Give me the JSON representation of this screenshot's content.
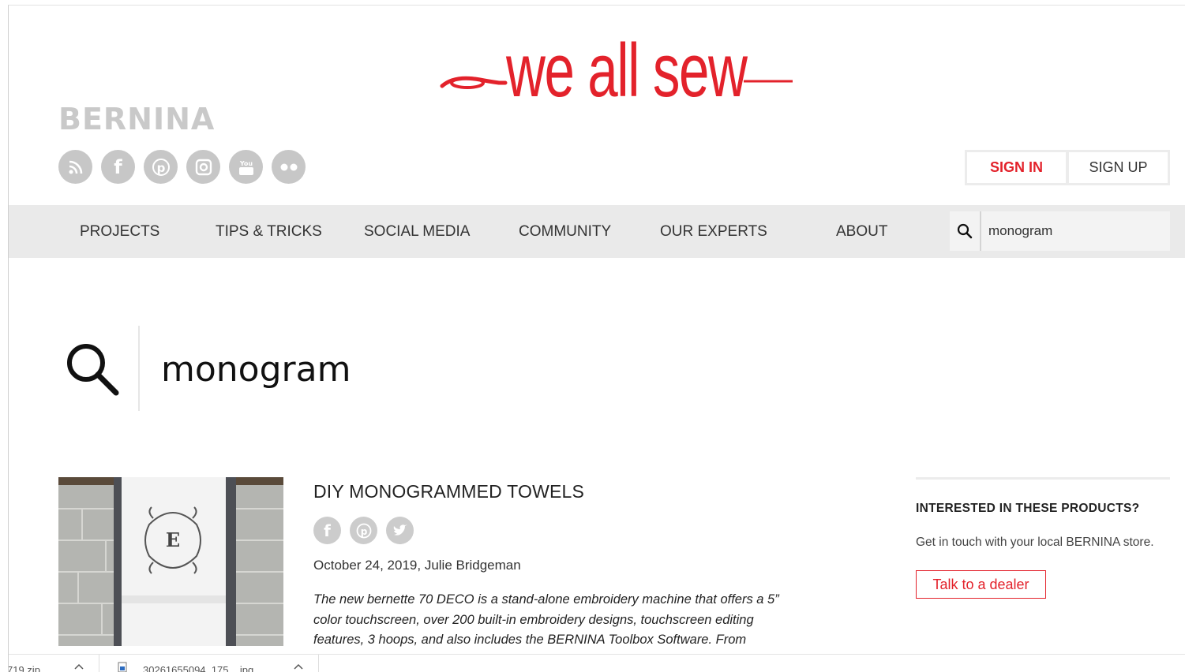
{
  "header": {
    "brand": "BERNINA",
    "logo_text": "we all sew",
    "social_icons": [
      "rss-icon",
      "facebook-icon",
      "pinterest-icon",
      "instagram-icon",
      "youtube-icon",
      "flickr-icon"
    ],
    "auth": {
      "sign_in": "SIGN IN",
      "sign_up": "SIGN UP"
    }
  },
  "nav": {
    "items": [
      "PROJECTS",
      "TIPS & TRICKS",
      "SOCIAL MEDIA",
      "COMMUNITY",
      "OUR EXPERTS",
      "ABOUT"
    ],
    "search_value": "monogram"
  },
  "search": {
    "query": "monogram"
  },
  "result": {
    "title": "DIY MONOGRAMMED TOWELS",
    "share_icons": [
      "facebook-icon",
      "pinterest-icon",
      "twitter-icon"
    ],
    "meta": "October 24, 2019, Julie Bridgeman",
    "excerpt": "The new bernette 70 DECO is a stand-alone embroidery machine that offers a 5” color touchscreen, over 200 built-in embroidery designs, touchscreen editing features, 3 hoops, and also includes the BERNINA Toolbox Software. From",
    "thumbnail_letter": "E"
  },
  "sidebar": {
    "heading": "INTERESTED IN THESE PRODUCTS?",
    "text": "Get in touch with your local BERNINA store.",
    "button": "Talk to a dealer"
  },
  "downloads": {
    "item1": "719.zip",
    "item2": "30261655094_175....jpg"
  },
  "colors": {
    "accent": "#e3222b",
    "nav_bg": "#eaeaea",
    "icon_grey": "#c7c7c7"
  }
}
